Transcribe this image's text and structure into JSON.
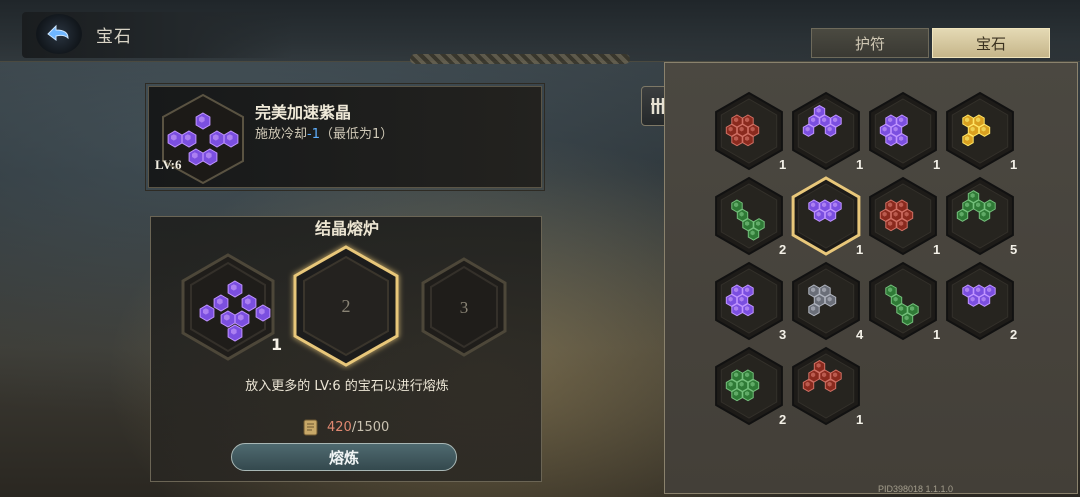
{
  "header": {
    "title": "宝石",
    "tabs": [
      {
        "label": "护符",
        "selected": false
      },
      {
        "label": "宝石",
        "selected": true
      }
    ]
  },
  "selected_gem": {
    "name": "完美加速紫晶",
    "desc_prefix": "施放冷却",
    "desc_value": "-1",
    "desc_suffix": "（最低为1）",
    "level": "LV:6"
  },
  "furnace": {
    "title": "结晶熔炉",
    "slots": [
      {
        "label": "",
        "count": "1",
        "filled": true
      },
      {
        "label": "2",
        "filled": false,
        "highlighted": true
      },
      {
        "label": "3",
        "filled": false
      }
    ],
    "hint": "放入更多的 LV:6 的宝石以进行熔炼",
    "cost_current": "420",
    "cost_max": "/1500",
    "button_label": "熔炼"
  },
  "inventory": {
    "items": [
      {
        "color": "red",
        "count": "1"
      },
      {
        "color": "purple",
        "count": "1"
      },
      {
        "color": "purple",
        "count": "1"
      },
      {
        "color": "gold",
        "count": "1"
      },
      {
        "color": "green",
        "count": "2"
      },
      {
        "color": "purple",
        "count": "1",
        "selected": true
      },
      {
        "color": "red",
        "count": "1"
      },
      {
        "color": "green",
        "count": "5"
      },
      {
        "color": "purple",
        "count": "3"
      },
      {
        "color": "gray",
        "count": "4"
      },
      {
        "color": "green",
        "count": "1"
      },
      {
        "color": "purple",
        "count": "2"
      },
      {
        "color": "green",
        "count": "2"
      },
      {
        "color": "red",
        "count": "1"
      }
    ]
  },
  "colors": {
    "purple": "#7b4fe0",
    "red": "#8a2a1e",
    "gold": "#d9a020",
    "green": "#2f7a36",
    "gray": "#6a6e78",
    "accent_gold": "#e8c77a"
  },
  "footer": {
    "pid": "PID398018  1.1.1.0"
  }
}
